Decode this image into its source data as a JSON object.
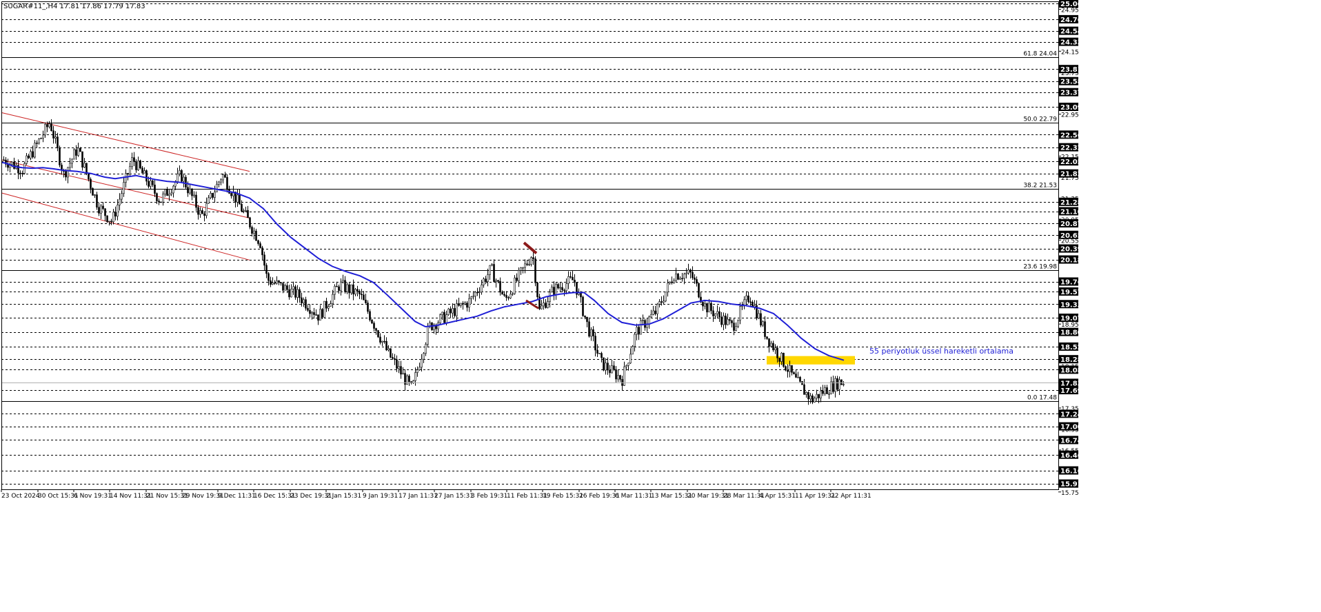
{
  "header": {
    "symbol": "SUGAR#11_,H4",
    "ohlc": "17.81 17.86 17.79 17.83"
  },
  "annotation": {
    "text": "55 periyotluk üssel hareketli ortalama",
    "color": "#1f1fd6",
    "highlight_color": "#ffd700"
  },
  "colors": {
    "candles": "#000000",
    "ema": "#1f1fd6",
    "channel": "#cc2222",
    "fib_line": "#000000",
    "grid": "#000000",
    "arrow": "#8b1a1a"
  },
  "chart_data": {
    "type": "candlestick",
    "title": "SUGAR#11_,H4",
    "ylim": [
      15.8,
      25.1
    ],
    "time_labels": [
      "23 Oct 2024",
      "30 Oct 15:31",
      "6 Nov 19:31",
      "14 Nov 11:31",
      "21 Nov 15:31",
      "29 Nov 19:31",
      "9 Dec 11:31",
      "16 Dec 15:31",
      "23 Dec 19:31",
      "2 Jan 15:31",
      "9 Jan 19:31",
      "17 Jan 11:31",
      "27 Jan 15:31",
      "3 Feb 19:31",
      "11 Feb 11:31",
      "19 Feb 15:31",
      "26 Feb 19:31",
      "6 Mar 11:31",
      "13 Mar 15:31",
      "20 Mar 19:31",
      "28 Mar 11:31",
      "4 Apr 15:31",
      "11 Apr 19:31",
      "22 Apr 11:31"
    ],
    "price_boxes": [
      "25.06",
      "24.76",
      "24.54",
      "24.33",
      "23.81",
      "23.58",
      "23.37",
      "23.09",
      "22.56",
      "22.32",
      "22.05",
      "21.82",
      "21.28",
      "21.10",
      "20.87",
      "20.65",
      "20.39",
      "20.18",
      "19.76",
      "19.57",
      "19.33",
      "19.07",
      "18.80",
      "18.52",
      "18.28",
      "18.08",
      "17.83",
      "17.69",
      "17.24",
      "17.00",
      "16.74",
      "16.46",
      "16.16",
      "15.91"
    ],
    "price_ticks": [
      "24.95",
      "24.15",
      "23.75",
      "22.95",
      "22.15",
      "21.75",
      "21.35",
      "20.95",
      "20.55",
      "18.95",
      "18.15",
      "17.35",
      "16.95",
      "16.55",
      "15.75"
    ],
    "fib_levels": [
      {
        "label": "61.8 24.04",
        "value": 24.04
      },
      {
        "label": "50.0 22.79",
        "value": 22.79
      },
      {
        "label": "38.2 21.53",
        "value": 21.53
      },
      {
        "label": "23.6 19.98",
        "value": 19.98
      },
      {
        "label": "0.0 17.48",
        "value": 17.48
      }
    ],
    "current_price": 17.83,
    "ema_period": 55,
    "ema_points": [
      [
        0,
        22.03
      ],
      [
        5,
        22.02
      ],
      [
        10,
        22.0
      ],
      [
        15,
        21.97
      ],
      [
        20,
        21.95
      ],
      [
        30,
        21.93
      ],
      [
        45,
        21.92
      ],
      [
        60,
        21.93
      ],
      [
        75,
        21.91
      ],
      [
        90,
        21.88
      ],
      [
        110,
        21.86
      ],
      [
        130,
        21.82
      ],
      [
        150,
        21.75
      ],
      [
        165,
        21.72
      ],
      [
        180,
        21.75
      ],
      [
        195,
        21.78
      ],
      [
        210,
        21.74
      ],
      [
        225,
        21.7
      ],
      [
        240,
        21.67
      ],
      [
        260,
        21.65
      ],
      [
        280,
        21.6
      ],
      [
        300,
        21.55
      ],
      [
        320,
        21.5
      ],
      [
        340,
        21.45
      ],
      [
        360,
        21.35
      ],
      [
        380,
        21.15
      ],
      [
        400,
        20.85
      ],
      [
        420,
        20.6
      ],
      [
        440,
        20.4
      ],
      [
        460,
        20.2
      ],
      [
        480,
        20.05
      ],
      [
        500,
        19.95
      ],
      [
        520,
        19.87
      ],
      [
        540,
        19.74
      ],
      [
        560,
        19.5
      ],
      [
        580,
        19.25
      ],
      [
        600,
        19.0
      ],
      [
        615,
        18.9
      ],
      [
        630,
        18.92
      ],
      [
        650,
        18.98
      ],
      [
        670,
        19.04
      ],
      [
        690,
        19.1
      ],
      [
        710,
        19.2
      ],
      [
        730,
        19.28
      ],
      [
        750,
        19.33
      ],
      [
        770,
        19.38
      ],
      [
        790,
        19.47
      ],
      [
        810,
        19.52
      ],
      [
        830,
        19.55
      ],
      [
        845,
        19.55
      ],
      [
        860,
        19.4
      ],
      [
        880,
        19.15
      ],
      [
        900,
        18.98
      ],
      [
        920,
        18.93
      ],
      [
        940,
        18.95
      ],
      [
        960,
        19.05
      ],
      [
        980,
        19.2
      ],
      [
        1000,
        19.35
      ],
      [
        1020,
        19.4
      ],
      [
        1040,
        19.38
      ],
      [
        1060,
        19.33
      ],
      [
        1080,
        19.3
      ],
      [
        1100,
        19.25
      ],
      [
        1120,
        19.15
      ],
      [
        1140,
        18.93
      ],
      [
        1160,
        18.68
      ],
      [
        1180,
        18.48
      ],
      [
        1200,
        18.35
      ],
      [
        1222,
        18.26
      ]
    ],
    "channel_lines": [
      {
        "from": [
          0,
          22.98
        ],
        "to": [
          360,
          21.86
        ]
      },
      {
        "from": [
          0,
          22.08
        ],
        "to": [
          360,
          20.97
        ]
      },
      {
        "from": [
          0,
          21.45
        ],
        "to": [
          360,
          20.17
        ]
      }
    ],
    "annotations": [
      {
        "type": "arrow",
        "near": [
          770,
          20.3
        ]
      },
      {
        "type": "arrow",
        "near": [
          770,
          19.3
        ]
      }
    ],
    "xlabel": "",
    "ylabel": ""
  }
}
